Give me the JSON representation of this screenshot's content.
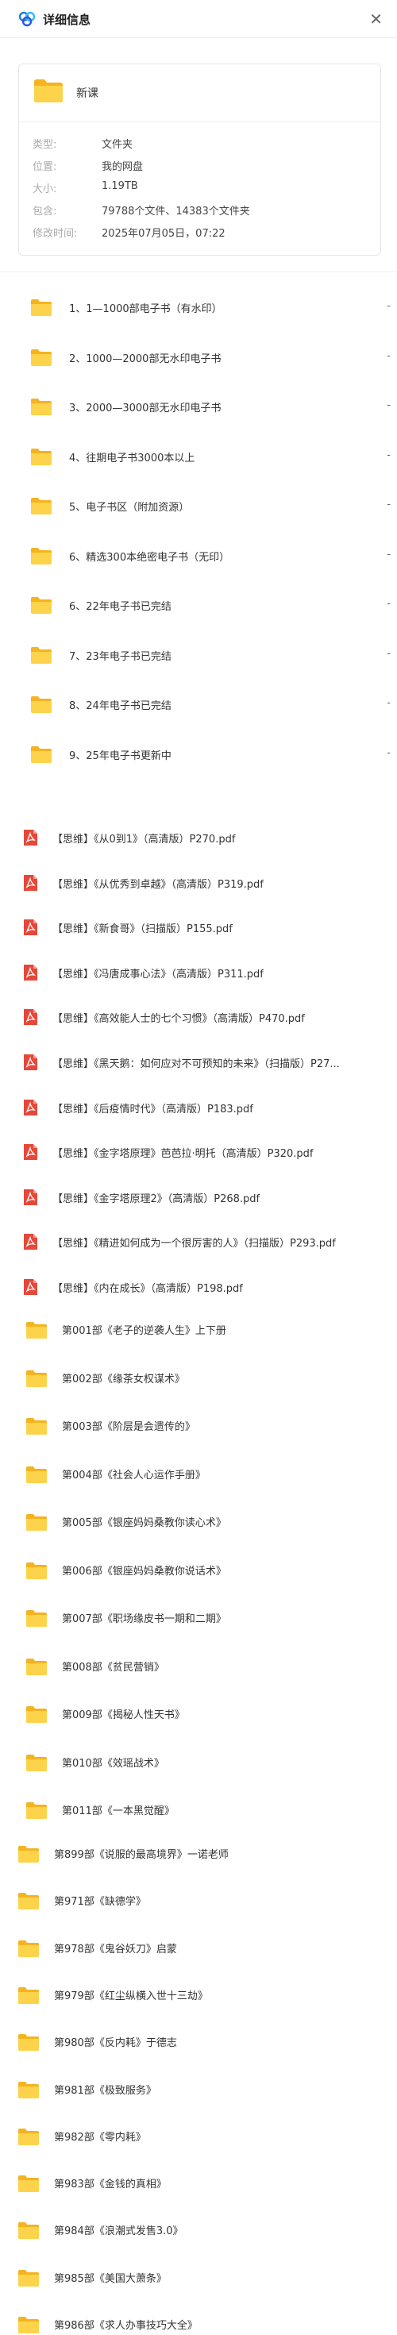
{
  "header": {
    "title": "详细信息",
    "close_symbol": "✕"
  },
  "card": {
    "name": "新课",
    "props": [
      {
        "label": "类型:",
        "value": "文件夹"
      },
      {
        "label": "位置:",
        "value": "我的网盘"
      },
      {
        "label": "大小:",
        "value": "1.19TB"
      },
      {
        "label": "包含:",
        "value": "79788个文件、14383个文件夹"
      },
      {
        "label": "修改时间:",
        "value": "2025年07月05日，07:22"
      }
    ]
  },
  "folders": [
    "1、1—1000部电子书（有水印）",
    "2、1000—2000部无水印电子书",
    "3、2000—3000部无水印电子书",
    "4、往期电子书3000本以上",
    "5、电子书区（附加资源）",
    "6、精选300本绝密电子书（无印）",
    "6、22年电子书已完结",
    "7、23年电子书已完结",
    "8、24年电子书已完结",
    "9、25年电子书更新中"
  ],
  "trailing_dash": "-",
  "pdfs": [
    "【思维】《从0到1》（高清版）P270.pdf",
    "【思维】《从优秀到卓越》（高清版）P319.pdf",
    "【思维】《新食哥》（扫描版）P155.pdf",
    "【思维】《冯唐成事心法》（高清版）P311.pdf",
    "【思维】《高效能人士的七个习惯》（高清版）P470.pdf",
    "【思维】《黑天鹅：如何应对不可预知的未来》（扫描版）P27...",
    "【思维】《后疫情时代》（高清版）P183.pdf",
    "【思维】《金字塔原理》芭芭拉·明托（高清版）P320.pdf",
    "【思维】《金字塔原理2》（高清版）P268.pdf",
    "【思维】《精进如何成为一个很厉害的人》（扫描版）P293.pdf",
    "【思维】《内在成长》（高清版）P198.pdf"
  ],
  "series_a": [
    "第001部《老子的逆袭人生》上下册",
    "第002部《缘茶女权谋术》",
    "第003部《阶层是会遗传的》",
    "第004部《社会人心运作手册》",
    "第005部《银座妈妈桑教你读心术》",
    "第006部《银座妈妈桑教你说话术》",
    "第007部《职场缘皮书一期和二期》",
    "第008部《贫民营销》",
    "第009部《揭秘人性天书》",
    "第010部《效瑶战术》",
    "第011部《一本黑觉醒》"
  ],
  "series_b": [
    "第899部《说服的最高境界》一诺老师",
    "第971部《缺德学》",
    "第978部《鬼谷妖刀》启蒙",
    "第979部《红尘纵横入世十三劫》",
    "第980部《反内耗》于德志",
    "第981部《极致服务》",
    "第982部《零内耗》",
    "第983部《金钱的真相》",
    "第984部《浪潮式发售3.0》",
    "第985部《美国大萧条》",
    "第986部《求人办事技巧大全》"
  ],
  "colors": {
    "folder": "#f9c42f",
    "pdf": "#e5483a",
    "accent": "#1f7ce8"
  }
}
